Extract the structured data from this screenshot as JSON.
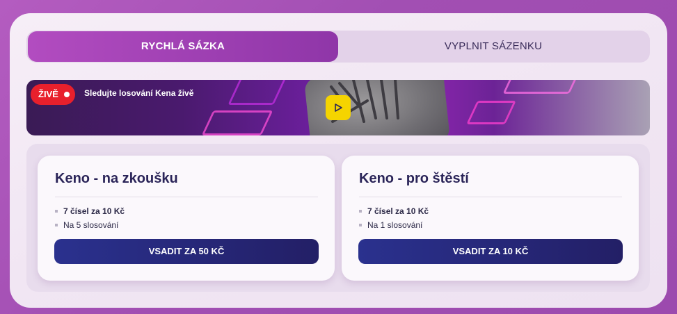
{
  "tabs": {
    "quick_bet": "RYCHLÁ SÁZKA",
    "fill_ticket": "VYPLNIT SÁZENKU"
  },
  "banner": {
    "live_label": "ŽIVĚ",
    "text": "Sledujte losování Kena živě"
  },
  "cards": [
    {
      "title": "Keno - na zkoušku",
      "items": [
        "7 čísel za 10 Kč",
        "Na 5 slosování"
      ],
      "button": "VSADIT ZA 50 KČ"
    },
    {
      "title": "Keno - pro štěstí",
      "items": [
        "7 čísel za 10 Kč",
        "Na 1 slosování"
      ],
      "button": "VSADIT ZA 10 KČ"
    }
  ],
  "colors": {
    "accent": "#a541b8",
    "live": "#e8202c",
    "button": "#272a7a",
    "play": "#f5d400"
  }
}
